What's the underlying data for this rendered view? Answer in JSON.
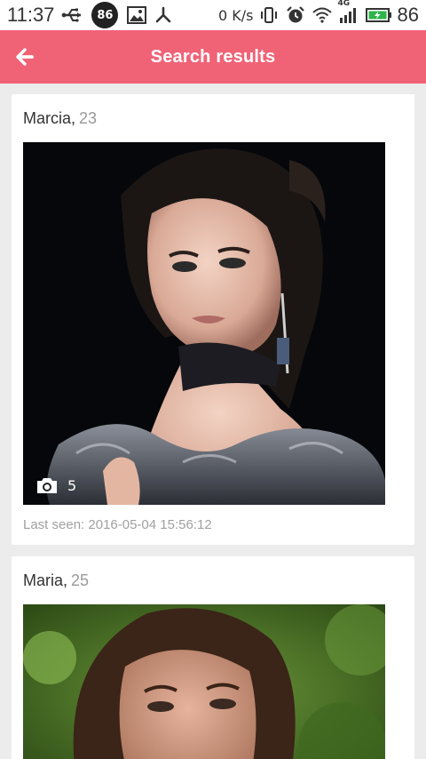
{
  "status_bar": {
    "time": "11:37",
    "badge": "86",
    "network_speed": "0 K/s",
    "network_type": "4G",
    "battery_level": "86"
  },
  "app_bar": {
    "title": "Search results",
    "back_icon": "arrow-left-icon"
  },
  "results": [
    {
      "name": "Marcia,",
      "age": "23",
      "photo_count": "5",
      "last_seen": "Last seen: 2016-05-04 15:56:12"
    },
    {
      "name": "Maria,",
      "age": "25"
    }
  ],
  "colors": {
    "accent": "#f06377",
    "background": "#ececec",
    "card": "#ffffff",
    "muted_text": "#a0a0a0"
  }
}
